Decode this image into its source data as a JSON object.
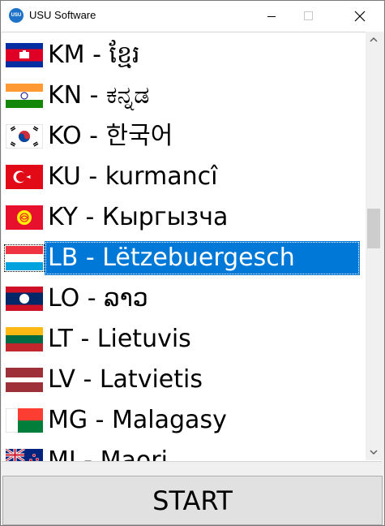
{
  "window": {
    "title": "USU Software",
    "app_icon_text": "USU"
  },
  "languages": [
    {
      "label": "KM - ខ្មែរ",
      "flag": "cambodia-flag",
      "selected": false
    },
    {
      "label": "KN - ಕನ್ನಡ",
      "flag": "india-flag",
      "selected": false
    },
    {
      "label": "KO - 한국어",
      "flag": "south-korea-flag",
      "selected": false
    },
    {
      "label": "KU - kurmancî",
      "flag": "turkey-flag",
      "selected": false
    },
    {
      "label": "KY - Кыргызча",
      "flag": "kyrgyzstan-flag",
      "selected": false
    },
    {
      "label": "LB - Lëtzebuergesch",
      "flag": "luxembourg-flag",
      "selected": true
    },
    {
      "label": "LO - ລາວ",
      "flag": "laos-flag",
      "selected": false
    },
    {
      "label": "LT - Lietuvis",
      "flag": "lithuania-flag",
      "selected": false
    },
    {
      "label": "LV - Latvietis",
      "flag": "latvia-flag",
      "selected": false
    },
    {
      "label": "MG - Malagasy",
      "flag": "madagascar-flag",
      "selected": false
    },
    {
      "label": "MI - Maori",
      "flag": "new-zealand-flag",
      "selected": false
    }
  ],
  "scrollbar": {
    "position_fraction": 0.45
  },
  "start_button": {
    "label": "START"
  },
  "colors": {
    "selection": "#0078d7",
    "button_face": "#e1e1e1"
  }
}
